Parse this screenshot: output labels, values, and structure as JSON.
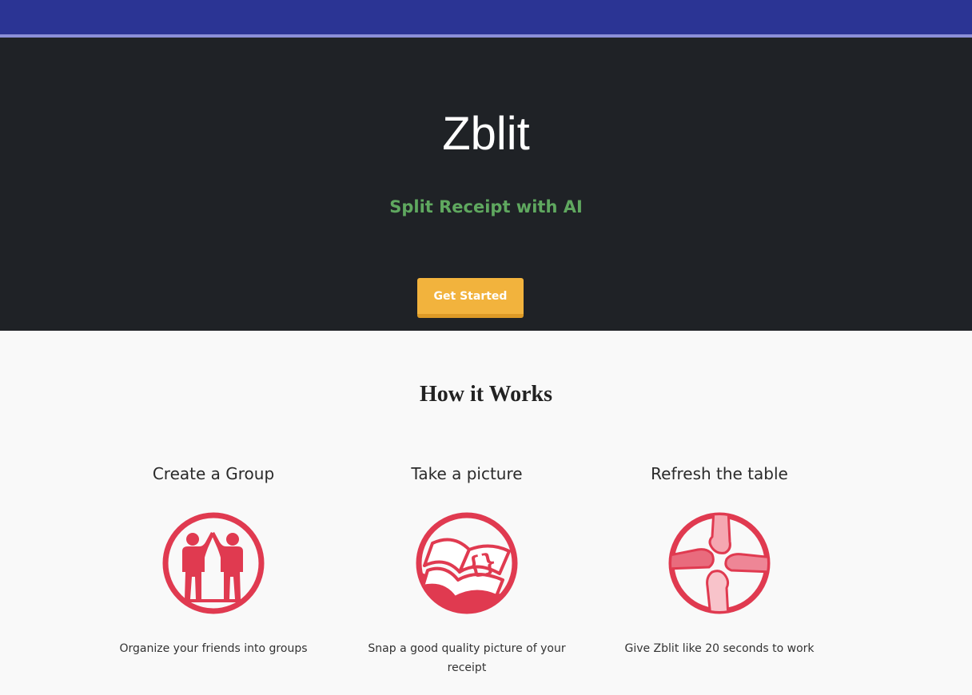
{
  "brand": {
    "title": "Zblit",
    "subtitle": "Split Receipt with AI",
    "cta_label": "Get Started"
  },
  "how_it_works": {
    "heading": "How it Works",
    "steps": [
      {
        "title": "Create a Group",
        "icon": "high-five-people-icon",
        "description": "Organize your friends into groups"
      },
      {
        "title": "Take a picture",
        "icon": "open-book-braces-icon",
        "description": "Snap a good quality picture of your receipt"
      },
      {
        "title": "Refresh the table",
        "icon": "stacked-hands-icon",
        "description": "Give Zblit like 20 seconds to work"
      }
    ]
  },
  "colors": {
    "top_bar": "#2b3494",
    "hero_background": "#1f2226",
    "subtitle": "#5fa85f",
    "cta": "#f2b33d",
    "icon_red": "#e03a50"
  }
}
